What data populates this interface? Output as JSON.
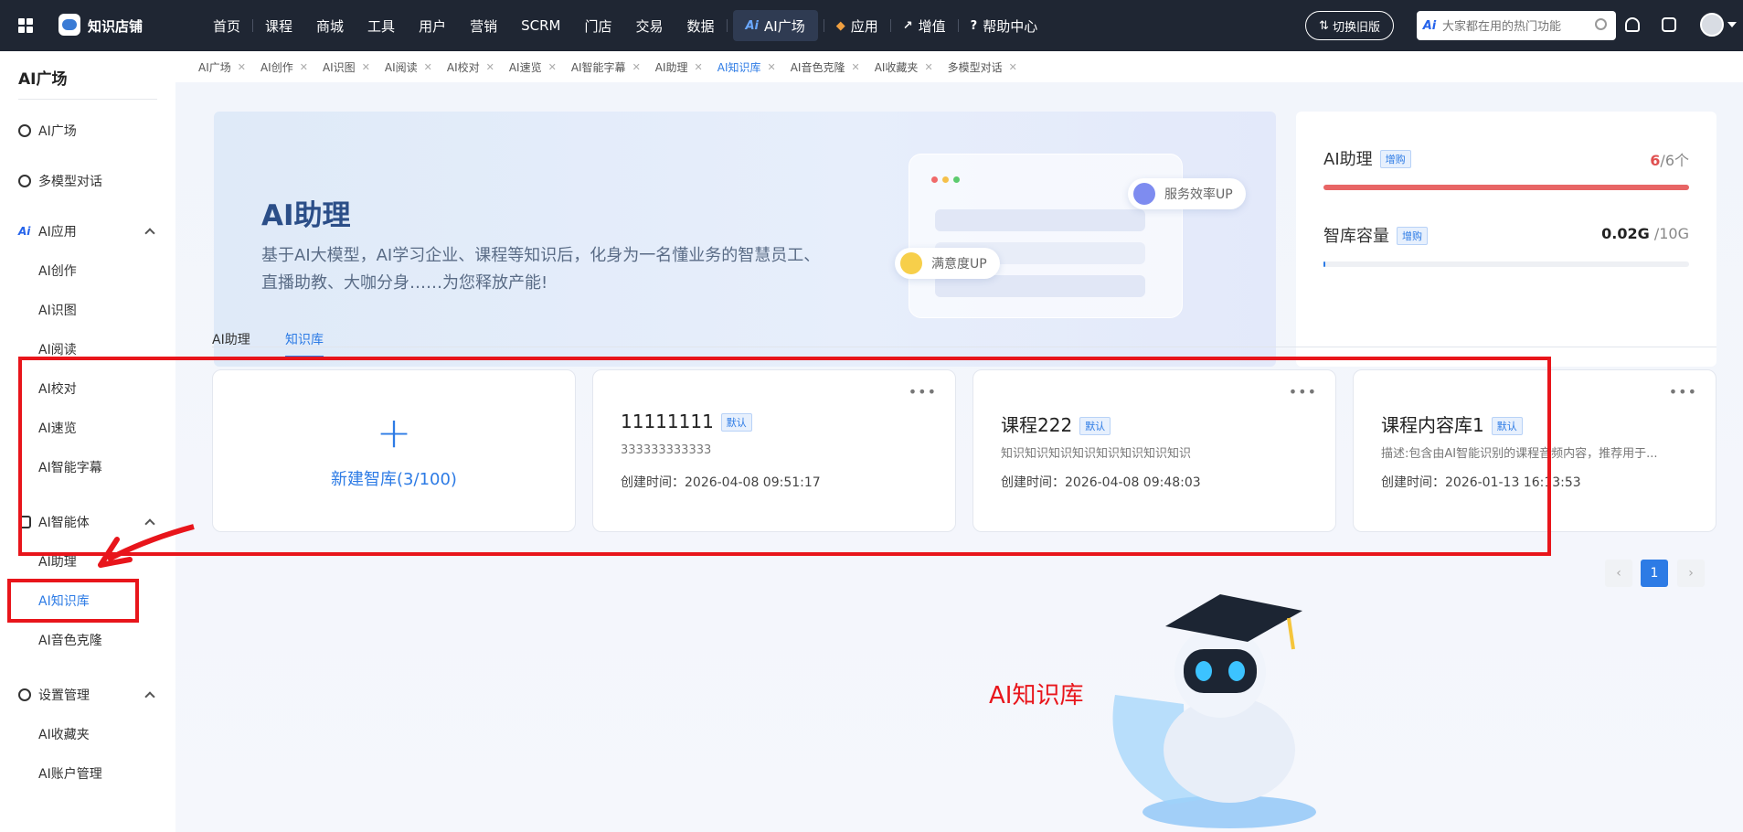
{
  "topbar": {
    "brand": "知识店铺",
    "nav": [
      {
        "label": "首页"
      },
      {
        "label": "课程"
      },
      {
        "label": "商城"
      },
      {
        "label": "工具"
      },
      {
        "label": "用户"
      },
      {
        "label": "营销"
      },
      {
        "label": "SCRM"
      },
      {
        "label": "门店"
      },
      {
        "label": "交易"
      },
      {
        "label": "数据"
      }
    ],
    "nav_active": {
      "icon": "Ai",
      "label": "AI广场"
    },
    "nav_apps": "应用",
    "nav_value_added": "增值",
    "nav_help": "帮助中心",
    "switch_old_label": "切换旧版",
    "search_icon_text": "Ai",
    "search_placeholder": "大家都在用的热门功能"
  },
  "sidebar": {
    "title": "AI广场",
    "items": [
      {
        "label": "AI广场",
        "icon": "pie-chart-icon"
      },
      {
        "label": "多模型对话",
        "icon": "chat-icon"
      }
    ],
    "groups": [
      {
        "label": "AI应用",
        "icon": "Ai",
        "children": [
          "AI创作",
          "AI识图",
          "AI阅读",
          "AI校对",
          "AI速览",
          "AI智能字幕"
        ]
      },
      {
        "label": "AI智能体",
        "icon": "robot-icon",
        "children": [
          "AI助理",
          "AI知识库",
          "AI音色克隆"
        ]
      },
      {
        "label": "设置管理",
        "icon": "gear-icon",
        "children": [
          "AI收藏夹",
          "AI账户管理"
        ]
      }
    ],
    "active": "AI知识库"
  },
  "tabs": [
    "AI广场",
    "AI创作",
    "AI识图",
    "AI阅读",
    "AI校对",
    "AI速览",
    "AI智能字幕",
    "AI助理",
    "AI知识库",
    "AI音色克隆",
    "AI收藏夹",
    "多模型对话"
  ],
  "active_tab": "AI知识库",
  "banner": {
    "title": "AI助理",
    "desc": "基于AI大模型，AI学习企业、课程等知识后，化身为一名懂业务的智慧员工、直播助教、大咖分身……为您释放产能!",
    "pill_efficiency": "服务效率UP",
    "pill_satisfaction": "满意度UP"
  },
  "quota": {
    "assistant_label": "AI助理",
    "assistant_badge": "增购",
    "assistant_used": "6",
    "assistant_total": "/6个",
    "assistant_ratio": 1.0,
    "storage_label": "智库容量",
    "storage_badge": "增购",
    "storage_used": "0.02G",
    "storage_total": " /10G",
    "storage_ratio": 0.002
  },
  "subtabs": [
    "AI助理",
    "知识库"
  ],
  "active_subtab": "知识库",
  "new_card_label": "新建智库(3/100)",
  "cards": [
    {
      "title": "11111111",
      "badge": "默认",
      "desc": "333333333333",
      "time_label": "创建时间：",
      "time": "2026-04-08 09:51:17"
    },
    {
      "title": "课程222",
      "badge": "默认",
      "desc": "知识知识知识知识知识知识知识知识",
      "time_label": "创建时间：",
      "time": "2026-04-08 09:48:03"
    },
    {
      "title": "课程内容库1",
      "badge": "默认",
      "desc": "描述:包含由AI智能识别的课程音频内容，推荐用于...",
      "time_label": "创建时间：",
      "time": "2026-01-13 16:13:53"
    }
  ],
  "more_icon": "•••",
  "pagination": {
    "prev": "‹",
    "current": "1",
    "next": "›"
  },
  "annotation_label": "AI知识库",
  "colors": {
    "accent": "#2d7be5",
    "annotation": "#e8151b",
    "topbar": "#1f2633"
  }
}
